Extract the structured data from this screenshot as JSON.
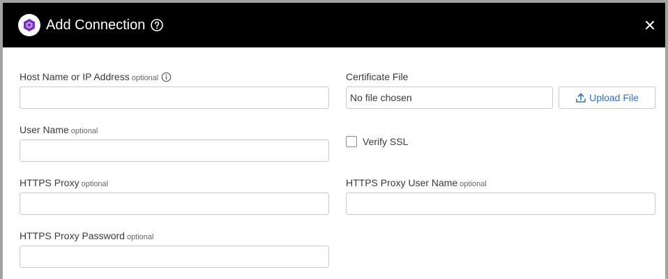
{
  "dialog": {
    "title": "Add Connection",
    "close_icon": "close-icon",
    "help_icon": "help-icon",
    "logo_icon": "hexagon-logo-icon"
  },
  "fields": {
    "host": {
      "label": "Host Name or IP Address",
      "optional": "optional",
      "value": ""
    },
    "user": {
      "label": "User Name",
      "optional": "optional",
      "value": ""
    },
    "proxy": {
      "label": "HTTPS Proxy",
      "optional": "optional",
      "value": ""
    },
    "proxy_password": {
      "label": "HTTPS Proxy Password",
      "optional": "optional",
      "value": ""
    },
    "certificate": {
      "label": "Certificate File",
      "status": "No file chosen",
      "upload_label": "Upload File"
    },
    "verify_ssl": {
      "label": "Verify SSL",
      "checked": false
    },
    "proxy_user": {
      "label": "HTTPS Proxy User Name",
      "optional": "optional",
      "value": ""
    }
  },
  "colors": {
    "header_bg": "#000000",
    "accent": "#2f6fd0",
    "logo_purple": "#7b2fbf"
  }
}
